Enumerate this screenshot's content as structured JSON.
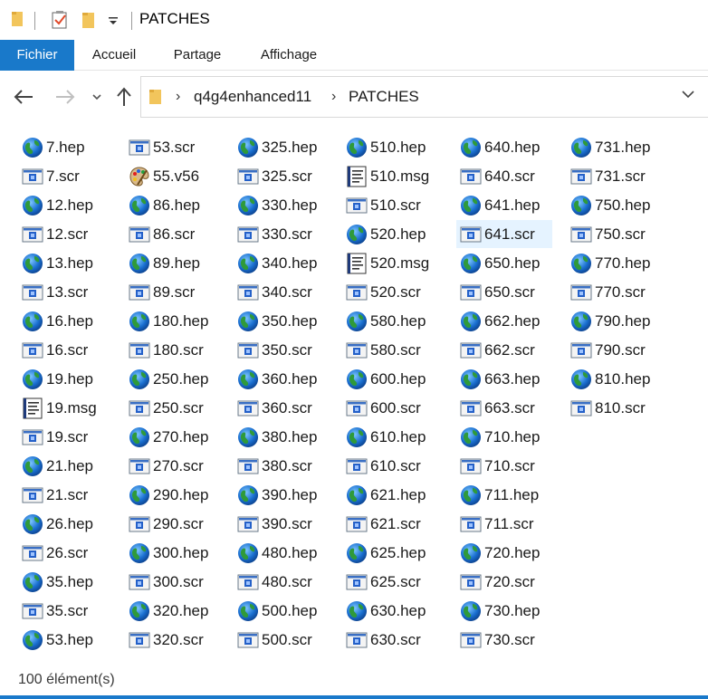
{
  "window": {
    "title": "PATCHES",
    "qat_dropdown_icon": "dropdown-icon"
  },
  "ribbon": {
    "tabs": [
      "Fichier",
      "Accueil",
      "Partage",
      "Affichage"
    ]
  },
  "address": {
    "parts": [
      "q4g4enhanced11",
      "PATCHES"
    ]
  },
  "selected_file": "641.scr",
  "columns": [
    [
      "7.hep",
      "7.scr",
      "12.hep",
      "12.scr",
      "13.hep",
      "13.scr",
      "16.hep",
      "16.scr",
      "19.hep",
      "19.msg",
      "19.scr",
      "21.hep",
      "21.scr",
      "26.hep",
      "26.scr",
      "35.hep",
      "35.scr",
      "53.hep"
    ],
    [
      "53.scr",
      "55.v56",
      "86.hep",
      "86.scr",
      "89.hep",
      "89.scr",
      "180.hep",
      "180.scr",
      "250.hep",
      "250.scr",
      "270.hep",
      "270.scr",
      "290.hep",
      "290.scr",
      "300.hep",
      "300.scr",
      "320.hep",
      "320.scr"
    ],
    [
      "325.hep",
      "325.scr",
      "330.hep",
      "330.scr",
      "340.hep",
      "340.scr",
      "350.hep",
      "350.scr",
      "360.hep",
      "360.scr",
      "380.hep",
      "380.scr",
      "390.hep",
      "390.scr",
      "480.hep",
      "480.scr",
      "500.hep",
      "500.scr"
    ],
    [
      "510.hep",
      "510.msg",
      "510.scr",
      "520.hep",
      "520.msg",
      "520.scr",
      "580.hep",
      "580.scr",
      "600.hep",
      "600.scr",
      "610.hep",
      "610.scr",
      "621.hep",
      "621.scr",
      "625.hep",
      "625.scr",
      "630.hep",
      "630.scr"
    ],
    [
      "640.hep",
      "640.scr",
      "641.hep",
      "641.scr",
      "650.hep",
      "650.scr",
      "662.hep",
      "662.scr",
      "663.hep",
      "663.scr",
      "710.hep",
      "710.scr",
      "711.hep",
      "711.scr",
      "720.hep",
      "720.scr",
      "730.hep",
      "730.scr"
    ],
    [
      "731.hep",
      "731.scr",
      "750.hep",
      "750.scr",
      "770.hep",
      "770.scr",
      "790.hep",
      "790.scr",
      "810.hep",
      "810.scr"
    ]
  ],
  "icons": {
    "hep": "globe-icon",
    "scr": "screensaver-icon",
    "msg": "message-file-icon",
    "v56": "palette-icon"
  },
  "status": {
    "count_text": "100 élément(s)"
  },
  "colors": {
    "accent": "#1979ca",
    "selection": "#e5f3ff"
  }
}
